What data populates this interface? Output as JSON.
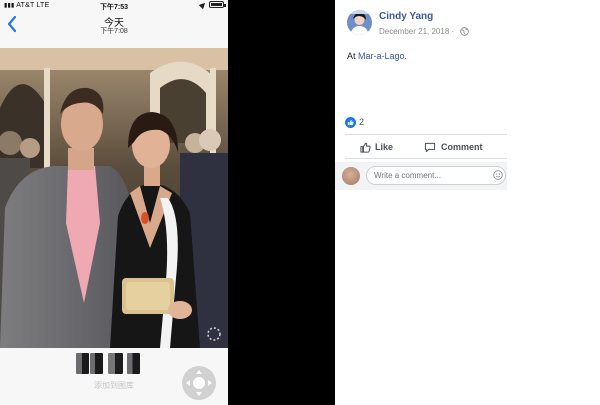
{
  "phone": {
    "status_bar": {
      "carrier": "AT&T",
      "network": "LTE",
      "time": "下午7:53"
    },
    "nav": {
      "back_icon": "chevron-left-icon",
      "title": "今天",
      "subtitle": "下午7:08"
    },
    "thumbnails": 3,
    "add_to_album_label": "添加到图库",
    "dpad_icon": "dpad-icon"
  },
  "post": {
    "author": "Cindy Yang",
    "date": "December 21, 2018",
    "date_separator": "·",
    "privacy_icon": "globe-icon",
    "text_prefix": "At ",
    "location": "Mar-a-Lago",
    "text_suffix": ".",
    "reaction_count": "2",
    "actions": {
      "like_label": "Like",
      "comment_label": "Comment"
    },
    "comment_placeholder": "Write a comment...",
    "colors": {
      "link": "#385898",
      "like_blue": "#1877f2",
      "muted": "#8a8d91"
    }
  }
}
